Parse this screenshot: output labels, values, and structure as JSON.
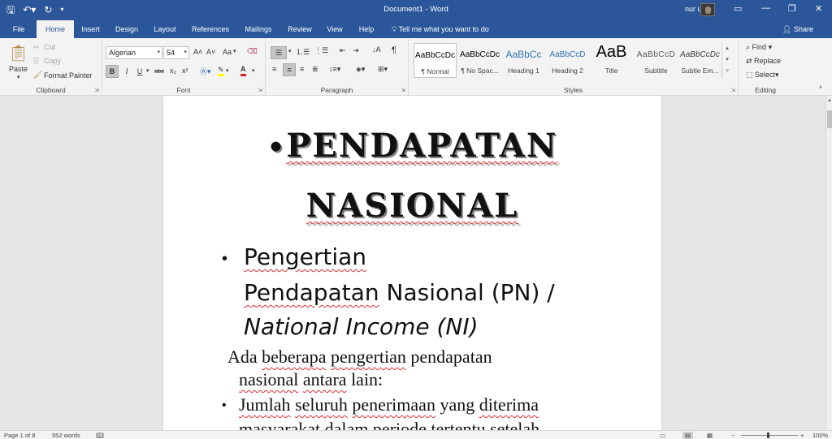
{
  "window": {
    "title": "Document1 - Word",
    "user_name": "nur us"
  },
  "qat": {
    "save_icon": "save-icon",
    "undo_icon": "undo-icon",
    "redo_icon": "redo-icon"
  },
  "tabs": [
    {
      "label": "File"
    },
    {
      "label": "Home"
    },
    {
      "label": "Insert"
    },
    {
      "label": "Design"
    },
    {
      "label": "Layout"
    },
    {
      "label": "References"
    },
    {
      "label": "Mailings"
    },
    {
      "label": "Review"
    },
    {
      "label": "View"
    },
    {
      "label": "Help"
    }
  ],
  "tell_me": "Tell me what you want to do",
  "share_label": "Share",
  "clipboard": {
    "label": "Clipboard",
    "paste": "Paste",
    "cut": "Cut",
    "copy": "Copy",
    "format_painter": "Format Painter"
  },
  "font": {
    "label": "Font",
    "name": "Algerian",
    "size": "54",
    "grow": "A˄",
    "shrink": "A˅",
    "case": "Aa",
    "bold": "B",
    "italic": "I",
    "underline": "U",
    "strike": "abc",
    "subscript": "x₂",
    "superscript": "x²"
  },
  "paragraph": {
    "label": "Paragraph",
    "pilcrow": "¶"
  },
  "styles": {
    "label": "Styles",
    "items": [
      {
        "sample": "AaBbCcDc",
        "name": "¶ Normal"
      },
      {
        "sample": "AaBbCcDc",
        "name": "¶ No Spac..."
      },
      {
        "sample": "AaBbCc",
        "name": "Heading 1"
      },
      {
        "sample": "AaBbCcD",
        "name": "Heading 2"
      },
      {
        "sample": "AaB",
        "name": "Title"
      },
      {
        "sample": "AaBbCcD",
        "name": "Subtitle"
      },
      {
        "sample": "AaBbCcDc",
        "name": "Subtle Em..."
      }
    ]
  },
  "editing": {
    "label": "Editing",
    "find": "Find",
    "replace": "Replace",
    "select": "Select"
  },
  "document": {
    "title_line1": "PENDAPATAN",
    "title_line2": "NASIONAL",
    "sub_word1": "Pengertian",
    "sub_word2": "Pendapatan",
    "sub_rest2": " Nasional (PN) /",
    "sub_line3": "National Income (NI)",
    "intro_a": "Ada ",
    "intro_b": "beberapa",
    "intro_c": " ",
    "intro_d": "pengertian",
    "intro_e": " pendapatan",
    "intro2_a": "nasional",
    "intro2_b": " ",
    "intro2_c": "antara",
    "intro2_d": " lain:",
    "item1_a": "Jumlah",
    "item1_b": " ",
    "item1_c": "seluruh",
    "item1_d": " ",
    "item1_e": "penerimaan",
    "item1_f": " yang ",
    "item1_g": "diterima",
    "item2": "masyarakat dalam periode tertentu setelah"
  },
  "status": {
    "page": "Page 1 of 8",
    "words": "552 words",
    "zoom": "100%"
  }
}
